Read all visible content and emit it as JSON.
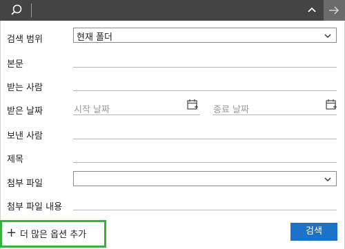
{
  "toolbar": {
    "search_icon": "search-icon",
    "collapse_icon": "chevron-up-icon",
    "next_icon": "arrow-right-icon"
  },
  "form": {
    "scope": {
      "label": "검색 범위",
      "value": "현재 폴더"
    },
    "body": {
      "label": "본문",
      "value": ""
    },
    "to": {
      "label": "받는 사람",
      "value": ""
    },
    "received_date": {
      "label": "받은 날짜",
      "start_placeholder": "시작 날짜",
      "end_placeholder": "종료 날짜"
    },
    "from": {
      "label": "보낸 사람",
      "value": ""
    },
    "subject": {
      "label": "제목",
      "value": ""
    },
    "attachment": {
      "label": "첨부 파일",
      "value": ""
    },
    "attachment_contents": {
      "label": "첨부 파일 내용",
      "value": ""
    }
  },
  "footer": {
    "add_more_label": "+ 더 많은 옵션 추가",
    "add_more_text": "더 많은 옵션 추가",
    "search_button": "검색"
  },
  "colors": {
    "toolbar_bg": "#444444",
    "accent": "#1a73c8",
    "highlight": "#35b240"
  }
}
